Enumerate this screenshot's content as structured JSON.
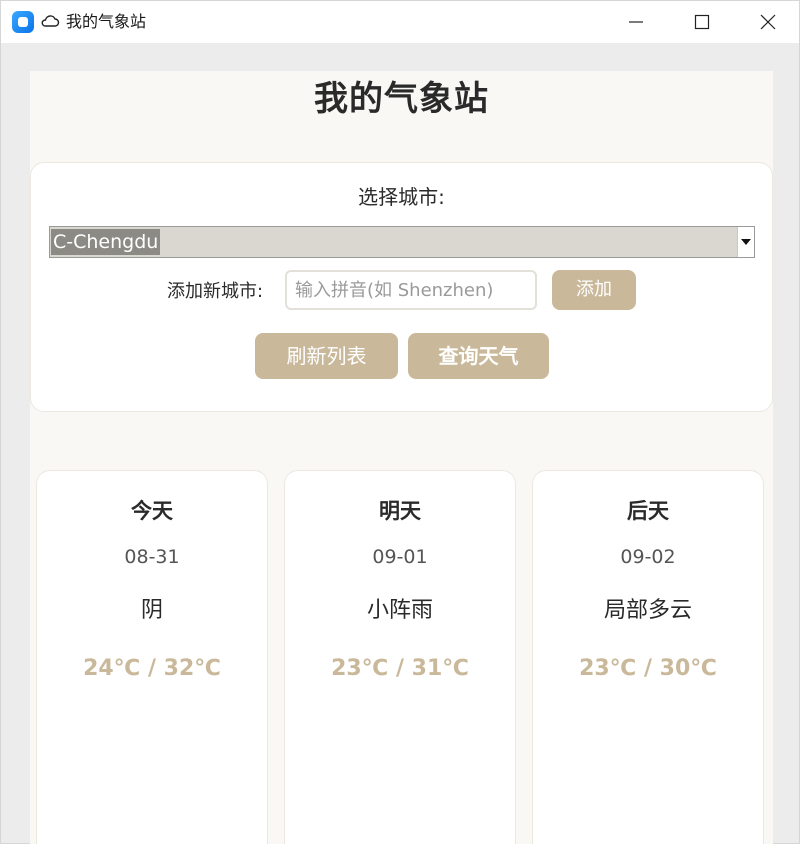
{
  "window": {
    "title": "我的气象站"
  },
  "page": {
    "title": "我的气象站"
  },
  "controls": {
    "select_label": "选择城市:",
    "selected_city": "C-Chengdu",
    "add_label": "添加新城市:",
    "add_placeholder": "输入拼音(如 Shenzhen)",
    "add_button": "添加",
    "refresh_button": "刷新列表",
    "query_button": "查询天气"
  },
  "forecast": [
    {
      "day": "今天",
      "date": "08-31",
      "condition": "阴",
      "temp": "24℃ / 32℃"
    },
    {
      "day": "明天",
      "date": "09-01",
      "condition": "小阵雨",
      "temp": "23℃ / 31℃"
    },
    {
      "day": "后天",
      "date": "09-02",
      "condition": "局部多云",
      "temp": "23℃ / 30℃"
    }
  ],
  "colors": {
    "accent": "#c9b99a",
    "page_bg": "#f9f8f5"
  }
}
